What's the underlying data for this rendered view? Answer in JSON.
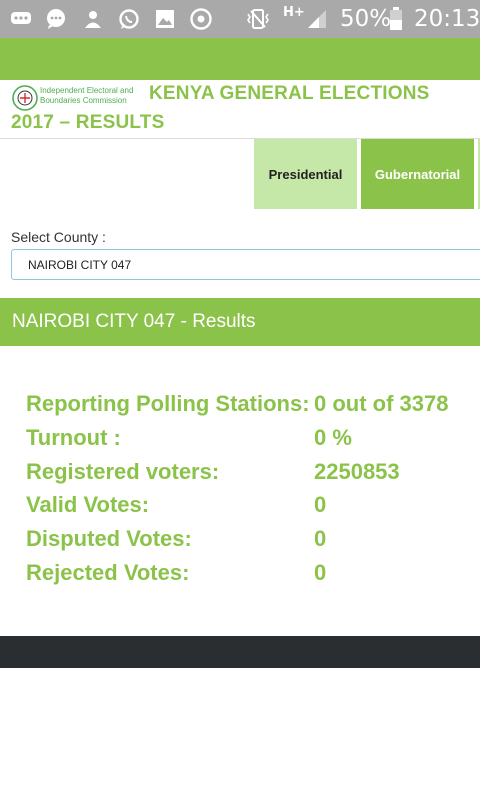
{
  "status_bar": {
    "battery": "50%",
    "time": "20:13",
    "network": "H+",
    "icons": [
      "messages-icon",
      "chat-icon",
      "person-icon",
      "whatsapp-icon",
      "gallery-icon",
      "chrome-icon",
      "vibrate-icon",
      "signal-icon",
      "battery-icon"
    ]
  },
  "header": {
    "logo_line1": "Independent Electoral and",
    "logo_line2": "Boundaries Commission",
    "title_line1": "KENYA GENERAL ELECTIONS",
    "title_line2": "2017 – RESULTS"
  },
  "tabs": {
    "presidential": "Presidential",
    "gubernatorial": "Gubernatorial"
  },
  "county": {
    "label": "Select County :",
    "selected": "NAIROBI CITY 047"
  },
  "results": {
    "banner": "NAIROBI CITY 047 - Results",
    "stats": [
      {
        "label": "Reporting Polling Stations:",
        "value": "0 out of 3378"
      },
      {
        "label": "Turnout :",
        "value": "0 %"
      },
      {
        "label": "Registered voters:",
        "value": "2250853"
      },
      {
        "label": "Valid Votes:",
        "value": "0"
      },
      {
        "label": "Disputed Votes:",
        "value": "0"
      },
      {
        "label": "Rejected Votes:",
        "value": "0"
      }
    ]
  },
  "colors": {
    "accent_green": "#8bc34a",
    "light_green": "#c5e8a8",
    "footer_dark": "#2b2e30",
    "status_bar": "#a9a9a9"
  }
}
